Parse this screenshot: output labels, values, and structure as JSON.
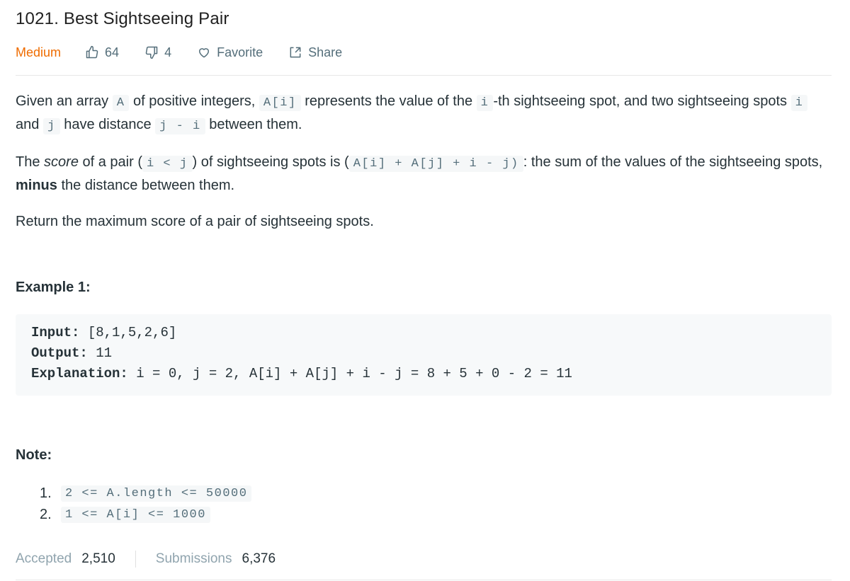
{
  "problem": {
    "title": "1021. Best Sightseeing Pair"
  },
  "meta": {
    "difficulty": "Medium",
    "likes": "64",
    "dislikes": "4",
    "favorite_label": "Favorite",
    "share_label": "Share",
    "colors": {
      "difficulty": "#ef6c00",
      "meta_text": "#546e7a"
    }
  },
  "description": {
    "p1": {
      "t1": "Given an array ",
      "c1": "A",
      "t2": " of positive integers, ",
      "c2": "A[i]",
      "t3": " represents the value of the ",
      "c3": "i",
      "t4": "-th sightseeing spot, and two sightseeing spots ",
      "c4": "i",
      "t5": " and ",
      "c5": "j",
      "t6": " have distance ",
      "c6": "j - i",
      "t7": " between them."
    },
    "p2": {
      "t1": "The ",
      "em": "score",
      "t2": " of a pair (",
      "c1": "i < j",
      "t3": ") of sightseeing spots is (",
      "c2": "A[i] + A[j] + i - j)",
      "t4": ": the sum of the values of the sightseeing spots, ",
      "strong": "minus",
      "t5": " the distance between them."
    },
    "p3": "Return the maximum score of a pair of sightseeing spots."
  },
  "example": {
    "title": "Example 1:",
    "input_label": "Input:",
    "input_value": " [8,1,5,2,6]",
    "output_label": "Output:",
    "output_value": " 11",
    "explanation_label": "Explanation:",
    "explanation_value": " i = 0, j = 2, A[i] + A[j] + i - j = 8 + 5 + 0 - 2 = 11"
  },
  "note": {
    "title": "Note:",
    "items": [
      {
        "num": "1.",
        "code": "2 <= A.length <= 50000"
      },
      {
        "num": "2.",
        "code": "1 <= A[i] <= 1000"
      }
    ]
  },
  "stats": {
    "accepted_label": "Accepted",
    "accepted_value": "2,510",
    "submissions_label": "Submissions",
    "submissions_value": "6,376"
  }
}
